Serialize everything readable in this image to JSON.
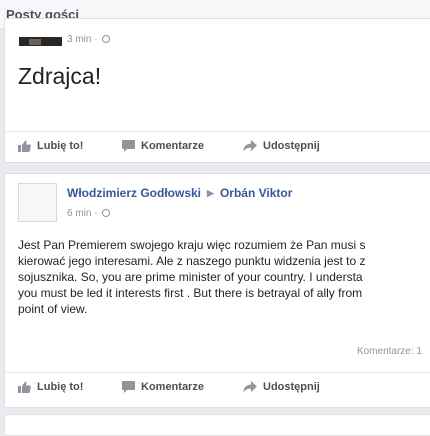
{
  "header": {
    "title": "Posty gości"
  },
  "posts": [
    {
      "time": "3 min",
      "text": "Zdrajca!",
      "actions": {
        "like": "Lubię to!",
        "comment": "Komentarze",
        "share": "Udostępnij"
      }
    },
    {
      "author": "Włodzimierz Godłowski",
      "target": "Orbán Viktor",
      "time": "6 min",
      "lines": [
        "Jest Pan Premierem swojego kraju więc rozumiem że Pan musi s",
        "kierować jego interesami. Ale z naszego punktu widzenia jest to z",
        "sojusznika. So, you are prime minister of your country. I understa",
        "you must be led it interests first . But there is betrayal of ally from",
        "point of view."
      ],
      "comment_count": "Komentarze: 1",
      "actions": {
        "like": "Lubię to!",
        "comment": "Komentarze",
        "share": "Udostępnij"
      }
    }
  ],
  "colors": {
    "link": "#365899",
    "meta": "#90949c",
    "action": "#4b4f56",
    "background": "#e9ebee"
  },
  "icons": {
    "like": "thumbs-up-icon",
    "comment": "comment-bubble-icon",
    "share": "share-arrow-icon",
    "privacy": "globe-icon",
    "separator": "triangle-right-icon",
    "avatar": "default-avatar-icon"
  }
}
